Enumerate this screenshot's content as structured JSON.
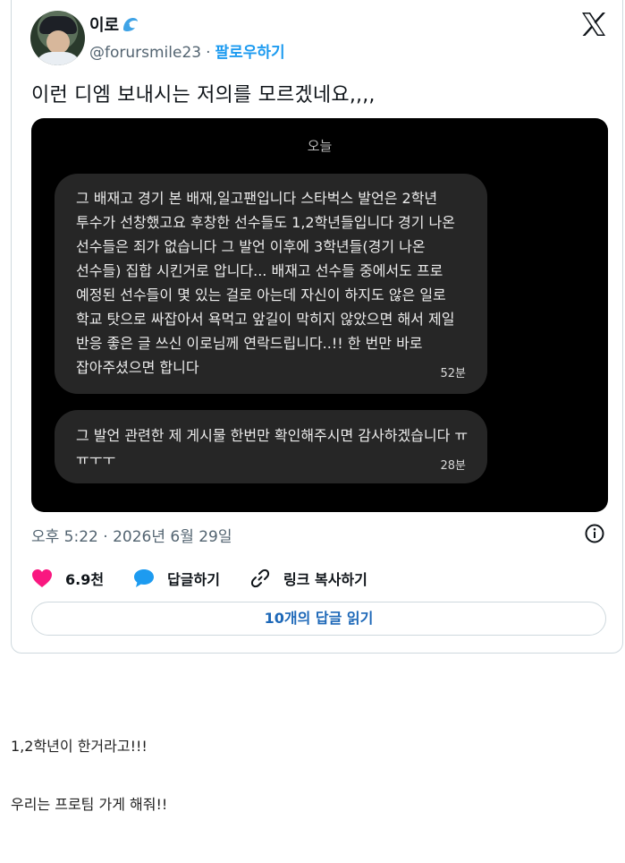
{
  "tweet": {
    "display_name": "이로",
    "name_icon": "wave-emoji",
    "handle": "@forursmile23",
    "separator": "·",
    "follow_label": "팔로우하기",
    "text": "이런 디엠 보내시는 저의를 모르겠네요,,,,",
    "timestamp": "오후 5:22 · 2026년 6월 29일",
    "icons": [
      "x-logo-icon",
      "info-icon",
      "heart-icon",
      "reply-bubble-icon",
      "link-icon"
    ],
    "colors": {
      "accent": "#1d9bf0",
      "like": "#f91880",
      "reply_link": "#1d68b8",
      "muted": "#536471"
    }
  },
  "dm": {
    "date_label": "오늘",
    "message1": {
      "lines": [
        "그 배재고 경기 본 배재,일고팬입니다 스타벅스 발언은 2학년",
        "투수가 선창했고요 후창한 선수들도 1,2학년들입니다 경기 나온",
        "선수들은 죄가 없습니다 그 발언 이후에 3학년들(경기 나온",
        "선수들) 집합 시킨거로 압니다... 배재고 선수들 중에서도 프로",
        "예정된 선수들이 몇 있는 걸로 아는데 자신이 하지도 않은 일로",
        "학교 탓으로 싸잡아서 욕먹고 앞길이 막히지 않았으면 해서 제일",
        "반응 좋은 글 쓰신 이로님께 연락드립니다..!! 한 번만 바로",
        "잡아주셨으면 합니다"
      ],
      "time": "52분"
    },
    "message2": {
      "lines": [
        "그 발언 관련한 제 게시물 한번만 확인해주시면 감사하겠습니다 ㅠ",
        "ㅠㅜㅜ"
      ],
      "time": "28분"
    }
  },
  "actions": {
    "likes": "6.9천",
    "reply_label": "답글하기",
    "copy_link_label": "링크 복사하기",
    "read_replies_label": "10개의 답글 읽기"
  },
  "post_body": {
    "line1": "1,2학년이 한거라고!!!",
    "line2": "우리는 프로팀 가게 해줘!!"
  }
}
